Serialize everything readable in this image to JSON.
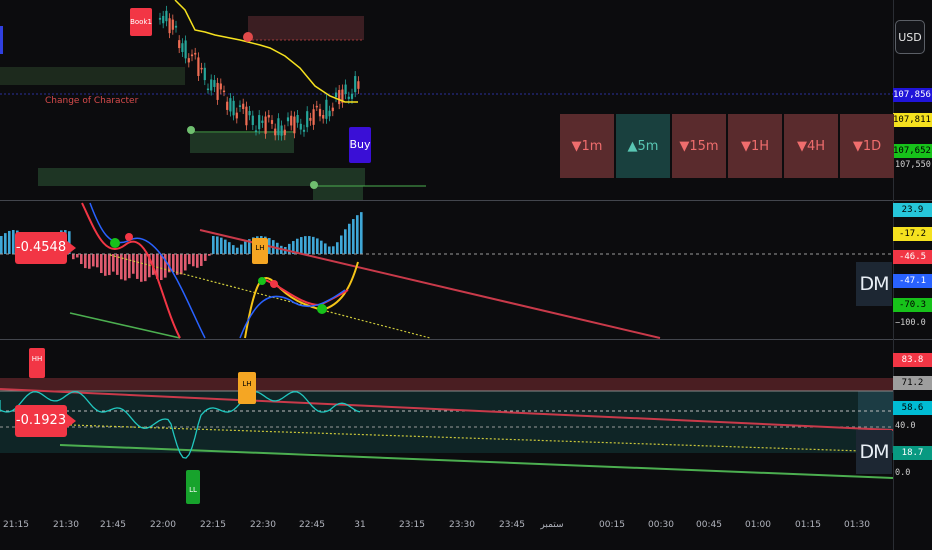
{
  "currency_button": "USD",
  "price_scale": {
    "tags": [
      {
        "value": "107,856.6",
        "bg": "#2014d9",
        "fg": "#ffffff"
      },
      {
        "value": "107,811.3",
        "bg": "#f5e11f",
        "fg": "#000000"
      },
      {
        "value": "107,652.4",
        "bg": "#17c21a",
        "fg": "#000000"
      }
    ],
    "extra_label": "107,550.0"
  },
  "timeframes": [
    {
      "label": "▼1m",
      "direction": "down"
    },
    {
      "label": "▲5m",
      "direction": "up"
    },
    {
      "label": "▼15m",
      "direction": "down"
    },
    {
      "label": "▼1H",
      "direction": "down"
    },
    {
      "label": "▼4H",
      "direction": "down"
    },
    {
      "label": "▼1D",
      "direction": "down"
    }
  ],
  "annotations": {
    "choch": "Change of Character",
    "book": "Book1",
    "buy": "Buy",
    "lh_1": "LH",
    "hh": "HH",
    "lh_2": "LH",
    "ll": "LL"
  },
  "pane1": {
    "badge": "-0.4548",
    "dm": "DM",
    "scale_tags": [
      {
        "value": "23.9",
        "bg": "#26c6da",
        "fg": "#000000"
      },
      {
        "value": "-17.2",
        "bg": "#f5e11f",
        "fg": "#000000"
      },
      {
        "value": "-46.5",
        "bg": "#f23645",
        "fg": "#ffffff"
      },
      {
        "value": "-47.1",
        "bg": "#2962ff",
        "fg": "#ffffff"
      },
      {
        "value": "-70.3",
        "bg": "#17c21a",
        "fg": "#000000"
      }
    ],
    "scale_text": "−100.0"
  },
  "pane2": {
    "badge": "-0.1923",
    "dm": "DM",
    "scale_tags": [
      {
        "value": "83.8",
        "bg": "#f23645",
        "fg": "#ffffff"
      },
      {
        "value": "71.2",
        "bg": "#9e9e9e",
        "fg": "#000000"
      },
      {
        "value": "58.6",
        "bg": "#00bcd4",
        "fg": "#000000"
      },
      {
        "value": "18.7",
        "bg": "#089981",
        "fg": "#ffffff"
      }
    ],
    "scale_text_1": "40.0",
    "scale_text_2": "0.0"
  },
  "time_axis": [
    "21:15",
    "21:30",
    "21:45",
    "22:00",
    "22:15",
    "22:30",
    "22:45",
    "31",
    "23:15",
    "23:30",
    "23:45",
    "ستمبر",
    "00:15",
    "00:30",
    "00:45",
    "01:00",
    "01:15",
    "01:30"
  ]
}
